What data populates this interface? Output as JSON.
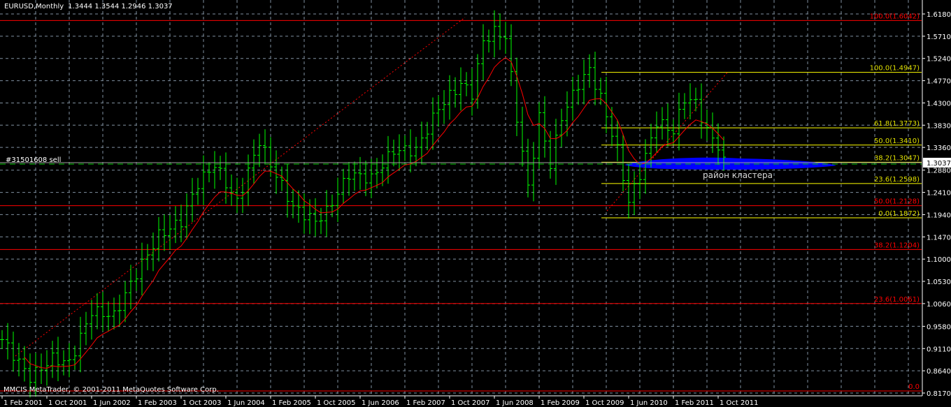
{
  "header": {
    "symbol_tf": "EURUSD,Monthly",
    "ohlc": "1.3444 1.3544 1.2946 1.3037"
  },
  "footer": {
    "copyright": "MMCIS MetaTrader, © 2001-2011 MetaQuotes Software Corp."
  },
  "order_label": "#31501608 sell",
  "cluster_label": "район кластера",
  "colors": {
    "background": "#000000",
    "bars": "#00ff00",
    "ma": "#ff0000",
    "fib_big": "#ff0000",
    "fib_small": "#ffff00",
    "cluster": "#0000ff",
    "grid": "#8090a0",
    "axis": "#ffffff"
  },
  "chart_data": {
    "type": "ohlc",
    "title": "EURUSD,Monthly",
    "ylim": [
      0.817,
      1.618
    ],
    "y_ticks": [
      "1.6180",
      "1.5710",
      "1.5240",
      "1.4770",
      "1.4300",
      "1.3830",
      "1.3360",
      "1.2880",
      "1.2410",
      "1.1940",
      "1.1470",
      "1.1000",
      "1.0530",
      "1.0060",
      "0.9580",
      "0.9110",
      "0.8640",
      "0.8170"
    ],
    "x_ticks": [
      "1 Feb 2001",
      "1 Oct 2001",
      "1 Jun 2002",
      "1 Feb 2003",
      "1 Oct 2003",
      "1 Jun 2004",
      "1 Feb 2005",
      "1 Oct 2005",
      "1 Jun 2006",
      "1 Feb 2007",
      "1 Oct 2007",
      "1 Jun 2008",
      "1 Feb 2009",
      "1 Oct 2009",
      "1 Jun 2010",
      "1 Feb 2011",
      "1 Oct 2011"
    ],
    "current_price": "1.3037",
    "approx_close_path": [
      [
        0,
        0.93
      ],
      [
        5,
        0.85
      ],
      [
        9,
        0.89
      ],
      [
        12,
        0.88
      ],
      [
        16,
        0.99
      ],
      [
        20,
        0.98
      ],
      [
        24,
        1.07
      ],
      [
        28,
        1.15
      ],
      [
        32,
        1.18
      ],
      [
        35,
        1.26
      ],
      [
        38,
        1.3
      ],
      [
        42,
        1.22
      ],
      [
        46,
        1.35
      ],
      [
        48,
        1.3
      ],
      [
        52,
        1.21
      ],
      [
        56,
        1.18
      ],
      [
        58,
        1.2
      ],
      [
        62,
        1.28
      ],
      [
        66,
        1.27
      ],
      [
        70,
        1.33
      ],
      [
        74,
        1.33
      ],
      [
        78,
        1.42
      ],
      [
        82,
        1.47
      ],
      [
        84,
        1.45
      ],
      [
        86,
        1.56
      ],
      [
        88,
        1.58
      ],
      [
        90,
        1.57
      ],
      [
        92,
        1.4
      ],
      [
        94,
        1.25
      ],
      [
        96,
        1.4
      ],
      [
        98,
        1.3
      ],
      [
        100,
        1.4
      ],
      [
        103,
        1.47
      ],
      [
        105,
        1.5
      ],
      [
        107,
        1.44
      ],
      [
        110,
        1.33
      ],
      [
        112,
        1.22
      ],
      [
        114,
        1.28
      ],
      [
        117,
        1.39
      ],
      [
        120,
        1.37
      ],
      [
        122,
        1.44
      ],
      [
        124,
        1.43
      ],
      [
        126,
        1.37
      ],
      [
        128,
        1.34
      ],
      [
        129,
        1.3037
      ]
    ],
    "fib_big": {
      "levels": [
        {
          "label": "100.0(1.6042)",
          "price": 1.6042
        },
        {
          "label": "50.0(1.2128)",
          "price": 1.2128
        },
        {
          "label": "38.2(1.1204)",
          "price": 1.1204
        },
        {
          "label": "23.6(1.0061)",
          "price": 1.0061
        },
        {
          "label": "0.0",
          "price": 0.8214
        }
      ]
    },
    "fib_small": {
      "levels": [
        {
          "label": "100.0(1.4947)",
          "price": 1.4947
        },
        {
          "label": "61.8(1.3773)",
          "price": 1.3773
        },
        {
          "label": "50.0(1.3410)",
          "price": 1.341
        },
        {
          "label": "38.2(1.3047)",
          "price": 1.3047
        },
        {
          "label": "23.6(1.2598)",
          "price": 1.2598
        },
        {
          "label": "0.0(1.1872)",
          "price": 1.1872
        }
      ]
    }
  }
}
